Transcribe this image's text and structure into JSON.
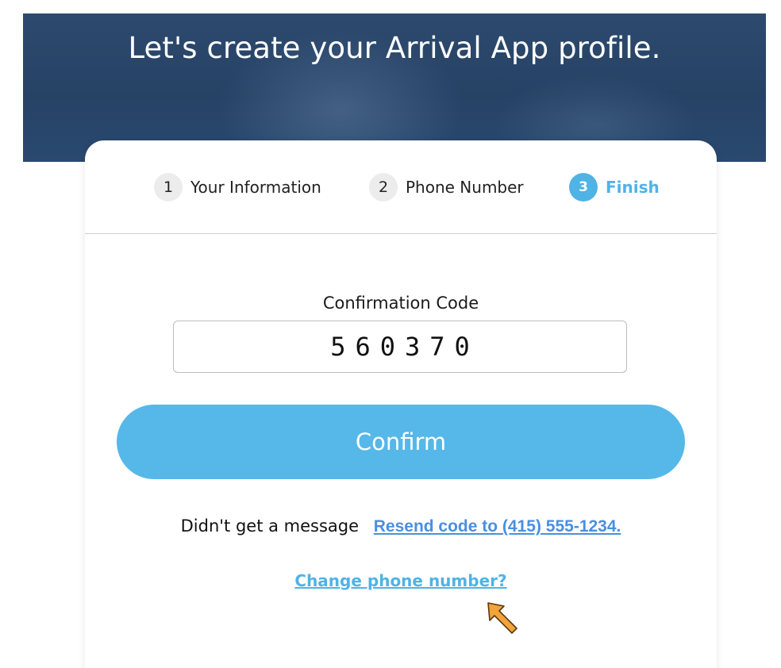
{
  "hero": {
    "title": "Let's create your Arrival App profile."
  },
  "steps": [
    {
      "number": "1",
      "label": "Your Information",
      "active": false
    },
    {
      "number": "2",
      "label": "Phone Number",
      "active": false
    },
    {
      "number": "3",
      "label": "Finish",
      "active": true
    }
  ],
  "form": {
    "code_label": "Confirmation Code",
    "code_value": "560370",
    "confirm_label": "Confirm"
  },
  "resend": {
    "prompt": "Didn't get a message",
    "link": "Resend code to (415) 555-1234."
  },
  "change_phone": {
    "link": "Change phone number?"
  },
  "colors": {
    "accent": "#55b8e8",
    "link_blue": "#4a8fe0",
    "hero_bg": "#2d4a6e",
    "annotation_arrow": "#f2a33a"
  },
  "annotation": {
    "icon": "pointer-arrow-icon"
  }
}
